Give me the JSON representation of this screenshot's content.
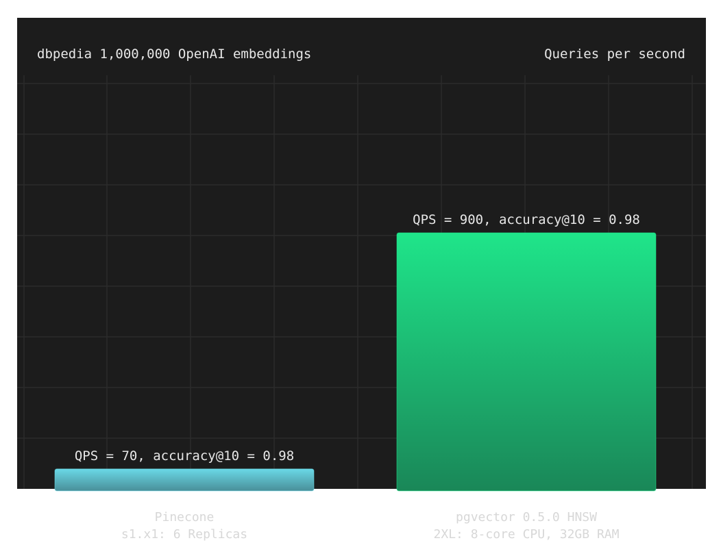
{
  "chart_data": {
    "type": "bar",
    "title": "dbpedia 1,000,000 OpenAI embeddings",
    "subtitle": "Queries per second",
    "categories": [
      {
        "name": "Pinecone",
        "detail": "s1.x1: 6 Replicas"
      },
      {
        "name": "pgvector 0.5.0 HNSW",
        "detail": "2XL: 8-core CPU, 32GB RAM"
      }
    ],
    "values": [
      70,
      900
    ],
    "data_labels": [
      "QPS = 70, accuracy@10 = 0.98",
      "QPS = 900, accuracy@10 = 0.98"
    ],
    "ylim": [
      0,
      1700
    ],
    "grid": true,
    "colors": {
      "background": "#1c1c1c",
      "grid": "#2b2b2b",
      "bar_pinecone_top": "#6ad8e6",
      "bar_pinecone_bottom": "#4a8f99",
      "bar_pgvector_top": "#1fe58a",
      "bar_pgvector_bottom": "#1a8758",
      "text": "#e8e8e8",
      "category_text": "#d7d7d7"
    }
  }
}
